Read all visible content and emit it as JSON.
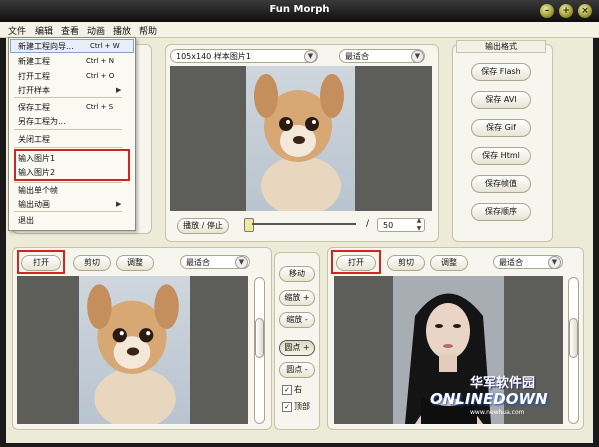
{
  "window": {
    "title": "Fun Morph"
  },
  "menubar": {
    "items": [
      "文件",
      "编辑",
      "查看",
      "动画",
      "播放",
      "帮助"
    ]
  },
  "file_menu": {
    "items": [
      {
        "label": "新建工程向导...",
        "shortcut": "Ctrl + W"
      },
      {
        "label": "新建工程",
        "shortcut": "Ctrl + N"
      },
      {
        "label": "打开工程",
        "shortcut": "Ctrl + O"
      },
      {
        "label": "打开样本",
        "shortcut": ""
      },
      {
        "label": "保存工程",
        "shortcut": "Ctrl + S"
      },
      {
        "label": "另存工程为...",
        "shortcut": ""
      },
      {
        "label": "关闭工程",
        "shortcut": ""
      },
      {
        "label": "输入图片1",
        "shortcut": ""
      },
      {
        "label": "输入图片2",
        "shortcut": ""
      },
      {
        "label": "输出单个帧",
        "shortcut": ""
      },
      {
        "label": "输出动画",
        "shortcut": ""
      },
      {
        "label": "退出",
        "shortcut": ""
      }
    ]
  },
  "preview": {
    "size_select": "105x140 样本图片1",
    "fit_select": "最适合",
    "play_button": "播放 / 停止",
    "frame_separator": "/",
    "frame_total": "50"
  },
  "output": {
    "heading": "输出格式",
    "buttons": [
      "保存 Flash",
      "保存 AVI",
      "保存 Gif",
      "保存 Html",
      "保存帧值",
      "保存顺序"
    ]
  },
  "left_image": {
    "open": "打开",
    "crop": "剪切",
    "adjust": "调整",
    "fit": "最适合"
  },
  "right_image": {
    "open": "打开",
    "crop": "剪切",
    "adjust": "调整",
    "fit": "最适合"
  },
  "tools": {
    "move": "移动",
    "zoom_in": "缩放 +",
    "zoom_out": "缩放 -",
    "dot_add": "圆点 +",
    "dot_remove": "圆点 -",
    "right_check": "右",
    "top_check": "顶部"
  },
  "watermark": {
    "cn": "华军软件园",
    "en": "ONLINEDOWN",
    "url": "www.newhua.com"
  },
  "colors": {
    "highlight_red": "#d32424",
    "viewer_gray": "#5d5d59",
    "panel_bg": "#f7f6ee",
    "titlebar": "#0e0e0e"
  }
}
